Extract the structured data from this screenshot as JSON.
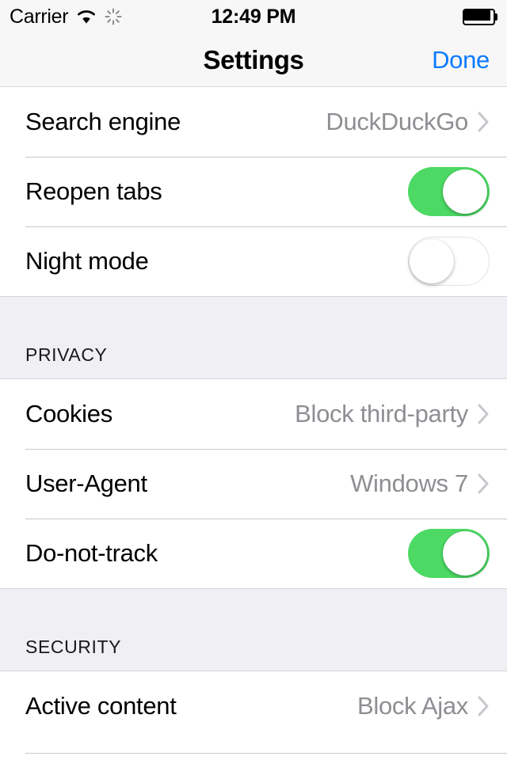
{
  "status_bar": {
    "carrier": "Carrier",
    "wifi_icon": "wifi-icon",
    "activity_icon": "activity-spinner-icon",
    "time": "12:49 PM",
    "battery_icon": "battery-full-icon"
  },
  "nav_bar": {
    "title": "Settings",
    "done_label": "Done",
    "accent_color": "#0a7cff"
  },
  "colors": {
    "toggle_on": "#4cd964",
    "value_text": "#8e8e93",
    "section_bg": "#efeff4",
    "separator": "#c8c7cc"
  },
  "sections": [
    {
      "header": null,
      "rows": [
        {
          "label": "Search engine",
          "type": "disclosure",
          "value": "DuckDuckGo",
          "chevron_icon": "chevron-right-icon"
        },
        {
          "label": "Reopen tabs",
          "type": "toggle",
          "value": "on"
        },
        {
          "label": "Night mode",
          "type": "toggle",
          "value": "off"
        }
      ]
    },
    {
      "header": "PRIVACY",
      "rows": [
        {
          "label": "Cookies",
          "type": "disclosure",
          "value": "Block third-party",
          "chevron_icon": "chevron-right-icon"
        },
        {
          "label": "User-Agent",
          "type": "disclosure",
          "value": "Windows 7",
          "chevron_icon": "chevron-right-icon"
        },
        {
          "label": "Do-not-track",
          "type": "toggle",
          "value": "on"
        }
      ]
    },
    {
      "header": "SECURITY",
      "rows": [
        {
          "label": "Active content",
          "type": "disclosure",
          "value": "Block Ajax",
          "chevron_icon": "chevron-right-icon"
        }
      ]
    }
  ]
}
